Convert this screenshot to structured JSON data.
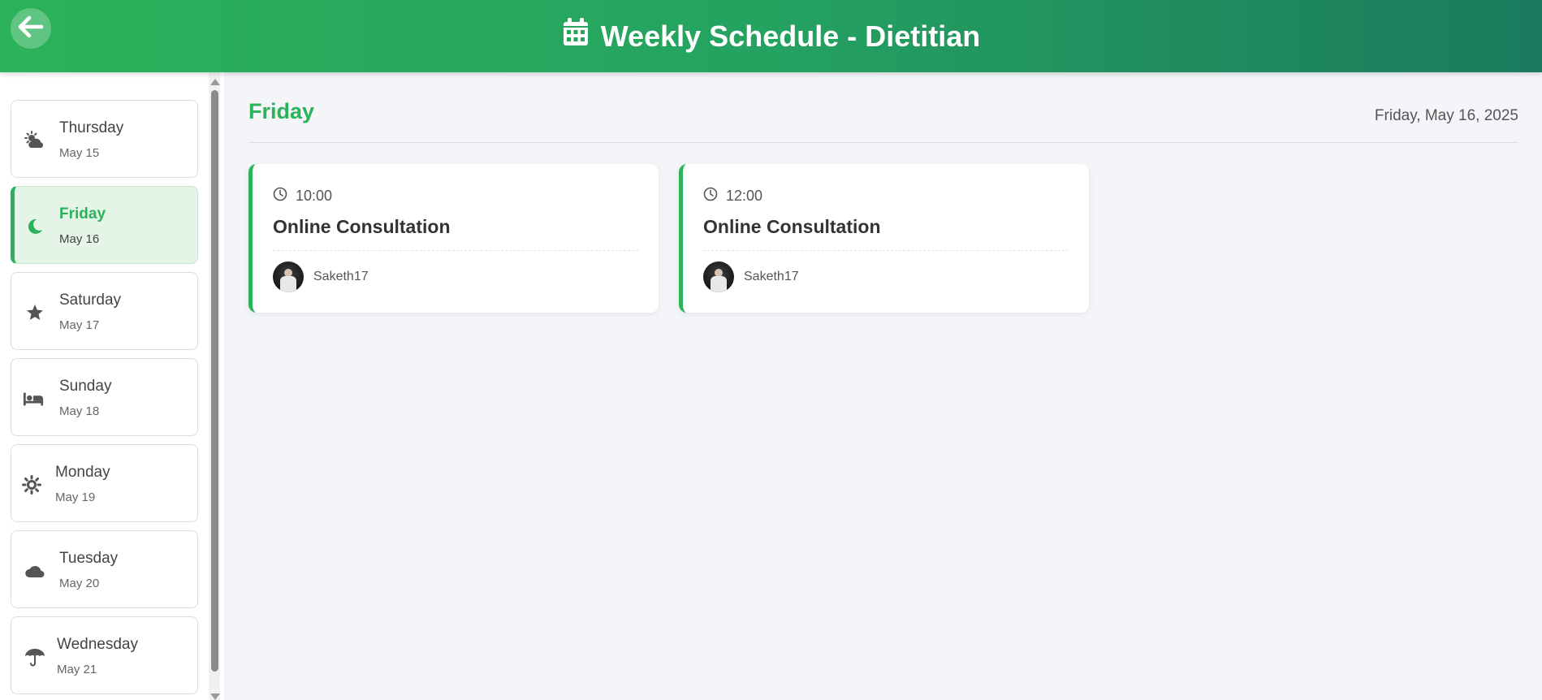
{
  "header": {
    "title": "Weekly Schedule - Dietitian",
    "back_icon": "arrow-left-icon",
    "title_icon": "calendar-icon"
  },
  "sidebar": {
    "days": [
      {
        "name": "Thursday",
        "date": "May 15",
        "icon": "cloud-sun-icon",
        "active": false
      },
      {
        "name": "Friday",
        "date": "May 16",
        "icon": "moon-icon",
        "active": true
      },
      {
        "name": "Saturday",
        "date": "May 17",
        "icon": "star-icon",
        "active": false
      },
      {
        "name": "Sunday",
        "date": "May 18",
        "icon": "bed-icon",
        "active": false
      },
      {
        "name": "Monday",
        "date": "May 19",
        "icon": "sun-icon",
        "active": false
      },
      {
        "name": "Tuesday",
        "date": "May 20",
        "icon": "cloud-icon",
        "active": false
      },
      {
        "name": "Wednesday",
        "date": "May 21",
        "icon": "umbrella-icon",
        "active": false
      }
    ]
  },
  "main": {
    "day_title": "Friday",
    "full_date": "Friday, May 16, 2025",
    "appointments": [
      {
        "time": "10:00",
        "title": "Online Consultation",
        "user": "Saketh17"
      },
      {
        "time": "12:00",
        "title": "Online Consultation",
        "user": "Saketh17"
      }
    ]
  },
  "colors": {
    "accent": "#2bb25a",
    "header_gradient_start": "#2bb25a",
    "header_gradient_end": "#1b7a5e",
    "background": "#f4f5f9"
  }
}
